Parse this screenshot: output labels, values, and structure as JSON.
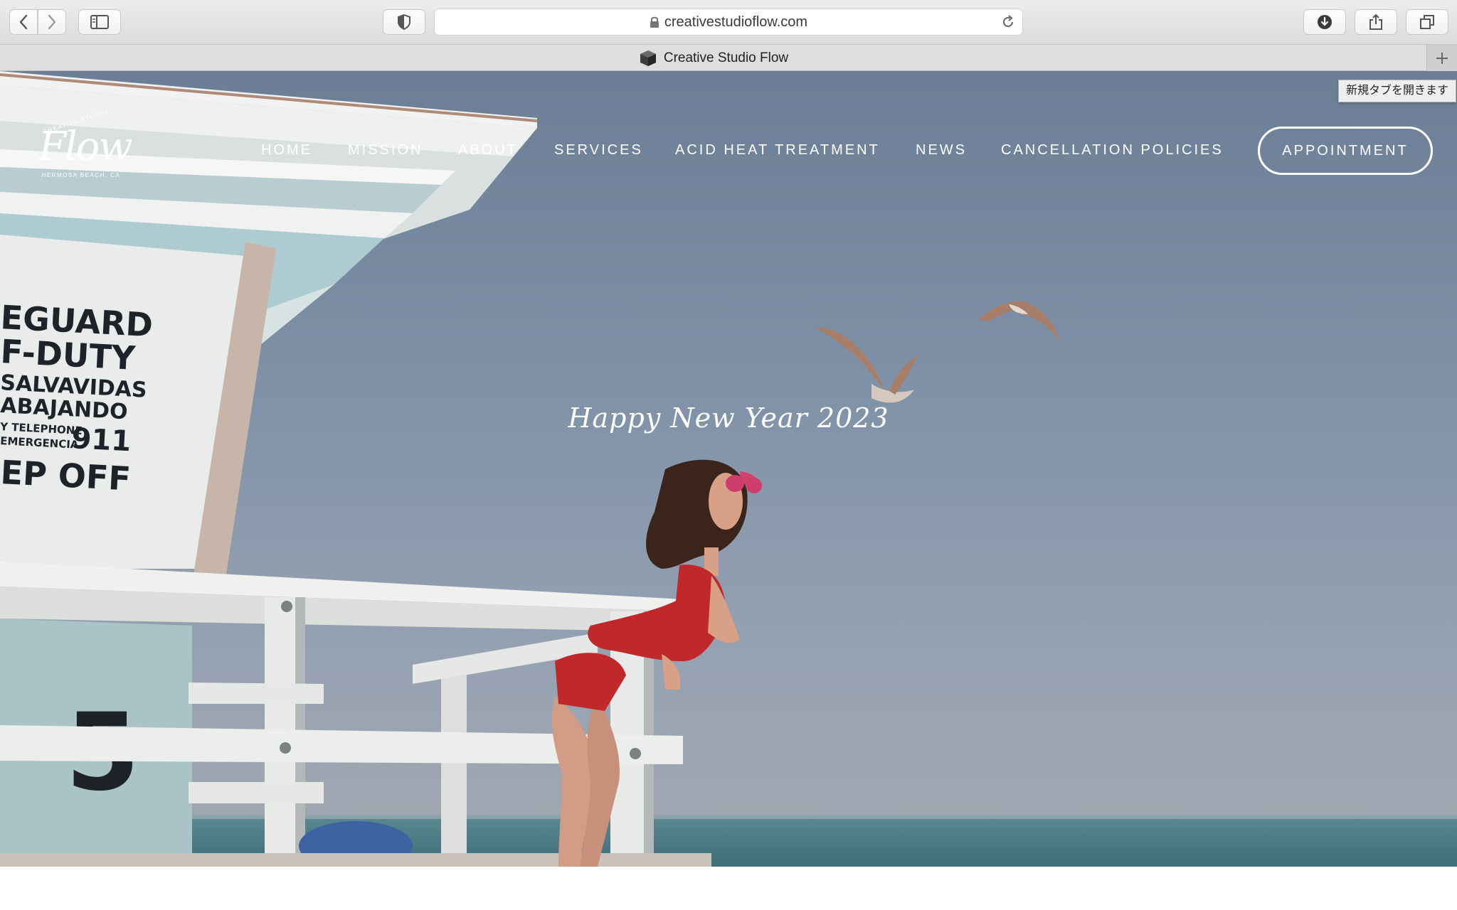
{
  "browser": {
    "url": "creativestudioflow.com",
    "tab_title": "Creative Studio Flow",
    "tooltip": "新規タブを開きます",
    "icons": [
      "back-icon",
      "forward-icon",
      "sidebar-icon",
      "privacy-shield-icon",
      "lock-icon",
      "reload-icon",
      "download-icon",
      "share-icon",
      "tabs-overview-icon",
      "plus-icon"
    ]
  },
  "site": {
    "logo": {
      "top": "CREATIVE STUDIO",
      "word": "Flow",
      "sub": "HERMOSA BEACH, CA"
    },
    "nav": {
      "items": [
        {
          "label": "HOME"
        },
        {
          "label": "MISSION"
        },
        {
          "label": "ABOUT"
        },
        {
          "label": "SERVICES"
        },
        {
          "label": "ACID HEAT TREATMENT"
        },
        {
          "label": "NEWS"
        },
        {
          "label": "CANCELLATION POLICIES"
        }
      ],
      "cta": "APPOINTMENT"
    },
    "hero": {
      "headline": "Happy New Year 2023",
      "sign_lines": [
        "EGUARD",
        "F-DUTY",
        "SALVAVIDAS",
        "ABAJANDO",
        "Y TELEPHONE",
        "EMERGENCIA",
        "911",
        "EP OFF"
      ],
      "tower_number": "5"
    }
  },
  "colors": {
    "sky_top": "#6c7e95",
    "sky_bottom": "#a3a8b0",
    "tower": "#e4e8e8",
    "tower_blue": "#b6ccd0",
    "swimsuit": "#c0282c",
    "sea": "#4f7d86",
    "nav_text": "#ffffff"
  }
}
